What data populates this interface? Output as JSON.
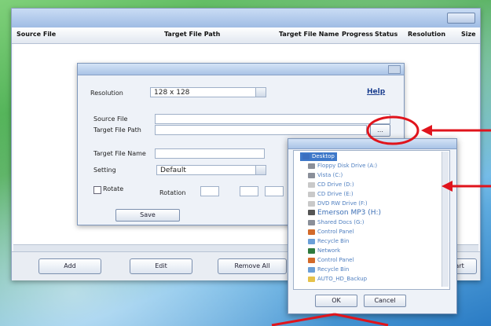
{
  "main": {
    "columns": [
      "Source File",
      "Target File Path",
      "Target File Name",
      "Progress",
      "Status",
      "Resolution",
      "Size"
    ],
    "buttons": [
      "Add",
      "Edit",
      "Remove All",
      "Start"
    ]
  },
  "dialog": {
    "resolution_label": "Resolution",
    "resolution_value": "128 x 128",
    "help": "Help",
    "source_file_label": "Source File",
    "target_path_label": "Target File Path",
    "target_name_label": "Target File Name",
    "setting_label": "Setting",
    "setting_value": "Default",
    "rotate_label": "Rotate",
    "rotation_label": "Rotation",
    "save_button": "Save"
  },
  "browser": {
    "items": [
      {
        "label": "Desktop",
        "type": "desktop"
      },
      {
        "label": "Floppy Disk Drive (A:)",
        "type": "drive"
      },
      {
        "label": "Vista (C:)",
        "type": "drive"
      },
      {
        "label": "CD Drive (D:)",
        "type": "cd"
      },
      {
        "label": "CD Drive (E:)",
        "type": "cd"
      },
      {
        "label": "DVD RW Drive (F:)",
        "type": "cd"
      },
      {
        "label": "Emerson MP3 (H:)",
        "type": "mp3"
      },
      {
        "label": "Shared Docs (G:)",
        "type": "drive"
      },
      {
        "label": "Control Panel",
        "type": "panel"
      },
      {
        "label": "Recycle Bin",
        "type": "bin"
      },
      {
        "label": "Network",
        "type": "net"
      },
      {
        "label": "Control Panel",
        "type": "panel"
      },
      {
        "label": "Recycle Bin",
        "type": "bin"
      },
      {
        "label": "AUTO_HD_Backup",
        "type": "folder"
      }
    ],
    "ok": "OK",
    "cancel": "Cancel"
  },
  "colors": {
    "accent": "#e0141c",
    "selection": "#3e78c9"
  }
}
